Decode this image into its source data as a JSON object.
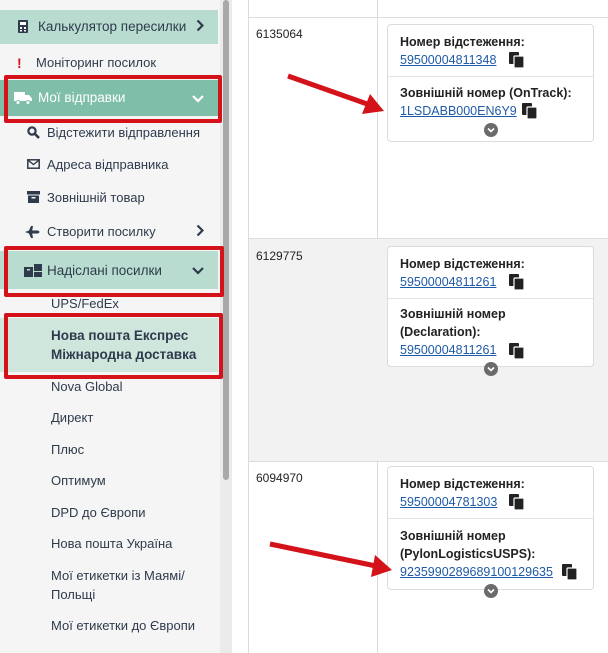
{
  "sidebar": {
    "calc": "Калькулятор пересилки",
    "monitoring": "Моніторинг посилок",
    "my_shipments": "Мої відправки",
    "track": "Відстежити відправлення",
    "sender_address": "Адреса відправника",
    "external_goods": "Зовнішній товар",
    "create_parcel": "Створити посилку",
    "sent_parcels": "Надіслані посилки",
    "sub": {
      "ups": "UPS/FedEx",
      "np_express_1": "Нова пошта Експрес",
      "np_express_2": "Міжнародна доставка",
      "nova_global": "Nova Global",
      "direct": "Директ",
      "plus": "Плюс",
      "optimum": "Оптимум",
      "dpd": "DPD до Європи",
      "np_ukraine": "Нова пошта Україна",
      "labels_miami_1": "Мої етикетки із Маямі/",
      "labels_miami_2": "Польщі",
      "labels_europe": "Мої етикетки до Європи"
    }
  },
  "rows": [
    {
      "id": "6135064",
      "tracking_label": "Номер відстеження:",
      "tracking_value": "59500004811348",
      "external_label_1": "Зовнішній номер (OnTrack):",
      "external_value": "1LSDABB000EN6Y9"
    },
    {
      "id": "6129775",
      "tracking_label": "Номер відстеження:",
      "tracking_value": "59500004811261",
      "external_label_1": "Зовнішній номер",
      "external_label_2": "(Declaration):",
      "external_value": "59500004811261"
    },
    {
      "id": "6094970",
      "tracking_label": "Номер відстеження:",
      "tracking_value": "59500004781303",
      "external_label_1": "Зовнішній номер",
      "external_label_2": "(PylonLogisticsUSPS):",
      "external_value": "9235990289689100129635"
    }
  ],
  "colors": {
    "accent_green": "#7fbfa9",
    "light_green": "#b9dcd0",
    "highlight_red": "#d4121a",
    "link_blue": "#1f5aa6"
  }
}
